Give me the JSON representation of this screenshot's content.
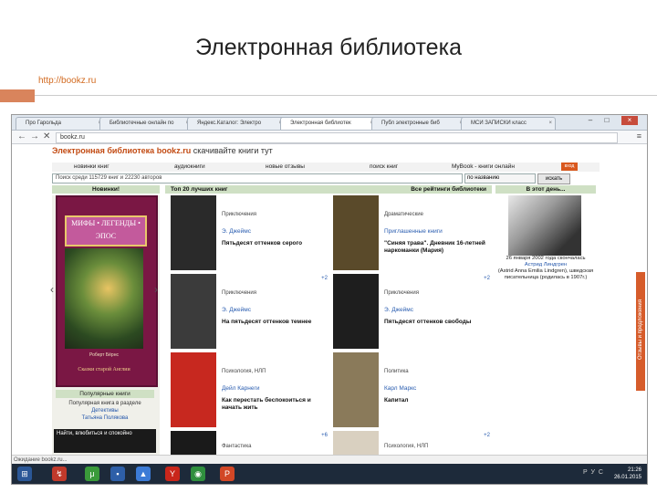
{
  "slide": {
    "title": "Электронная библиотека",
    "url": "http://bookz.ru"
  },
  "browser": {
    "tabs": [
      {
        "label": "Про Гарольда",
        "active": false
      },
      {
        "label": "Библиотечные онлайн по",
        "active": false
      },
      {
        "label": "Яндекс.Каталог: Электро",
        "active": false
      },
      {
        "label": "Электронная библиотек",
        "active": true
      },
      {
        "label": "Публ   электронные биб",
        "active": false
      },
      {
        "label": "МСИ ЗАПИСКИ  класс",
        "active": false
      }
    ],
    "address": "bookz.ru",
    "status": "Ожидание bookz.ru..."
  },
  "site": {
    "header": "Электронная библиотека bookz.ru",
    "header_tail": "скачивайте книги тут",
    "nav": [
      "новинки книг",
      "аудиокниги",
      "новые отзывы",
      "поиск книг",
      "MyBook - книги онлайн"
    ],
    "entry_label": "вход",
    "search_placeholder": "Поиск среди 115729 книг и 22230 авторов",
    "search_select": "по названию",
    "search_button": "искать",
    "col_new": "Новинки!",
    "col_top": "Топ 20 лучших книг",
    "col_ratings": "Все рейтинги библиотеки",
    "col_day": "В этот день..."
  },
  "featured_book": {
    "top_text": "МИФЫ • ЛЕГЕНДЫ • ЭПОС",
    "author": "Роберт Бёрнс",
    "title": "Сказки старой Англии"
  },
  "popular": {
    "head": "Популярные книги",
    "line1": "Популярная книга в разделе",
    "link1": "Детективы",
    "link2": "Татьяна Полякова",
    "banner": "Найти, влюбиться и спокойно"
  },
  "books": [
    {
      "genre": "Приключения",
      "author": "Э. Джеймс",
      "title": "Пятьдесят оттенков серого",
      "cover": "#2a2a2a",
      "plus": ""
    },
    {
      "genre": "Драматические",
      "author": "Приглашенные книги",
      "title": "\"Синяя трава\". Дневник 16-летней наркоманки (Мария)",
      "cover": "#5a4a2a",
      "plus": ""
    },
    {
      "genre": "Приключения",
      "author": "Э. Джеймс",
      "title": "На пятьдесят оттенков темнее",
      "cover": "#3b3b3b",
      "plus": "+2"
    },
    {
      "genre": "Приключения",
      "author": "Э. Джеймс",
      "title": "Пятьдесят оттенков свободы",
      "cover": "#1e1e1e",
      "plus": "+2"
    },
    {
      "genre": "Психология, НЛП",
      "author": "Дейл Карнеги",
      "title": "Как перестать беспокоиться и начать жить",
      "cover": "#c7281f",
      "plus": ""
    },
    {
      "genre": "Политика",
      "author": "Карл Маркс",
      "title": "Капитал",
      "cover": "#8a7a5a",
      "plus": ""
    },
    {
      "genre": "Фантастика",
      "author": "",
      "title": "",
      "cover": "#1a1a1a",
      "plus": "+6"
    },
    {
      "genre": "Психология, НЛП",
      "author": "",
      "title": "",
      "cover": "#d9d0c0",
      "plus": "+2"
    }
  ],
  "day": {
    "line1": "26 января 2002 года скончалась",
    "link": "Астрид Линдгрен",
    "line2": "(Astrid Anna Emilia Lindgren), шведская писательница (родилась в 1907г.)"
  },
  "feedback": "Отзывы и предложения",
  "taskbar": {
    "time": "21:26",
    "date": "26.01.2015",
    "lang": "РУС"
  }
}
